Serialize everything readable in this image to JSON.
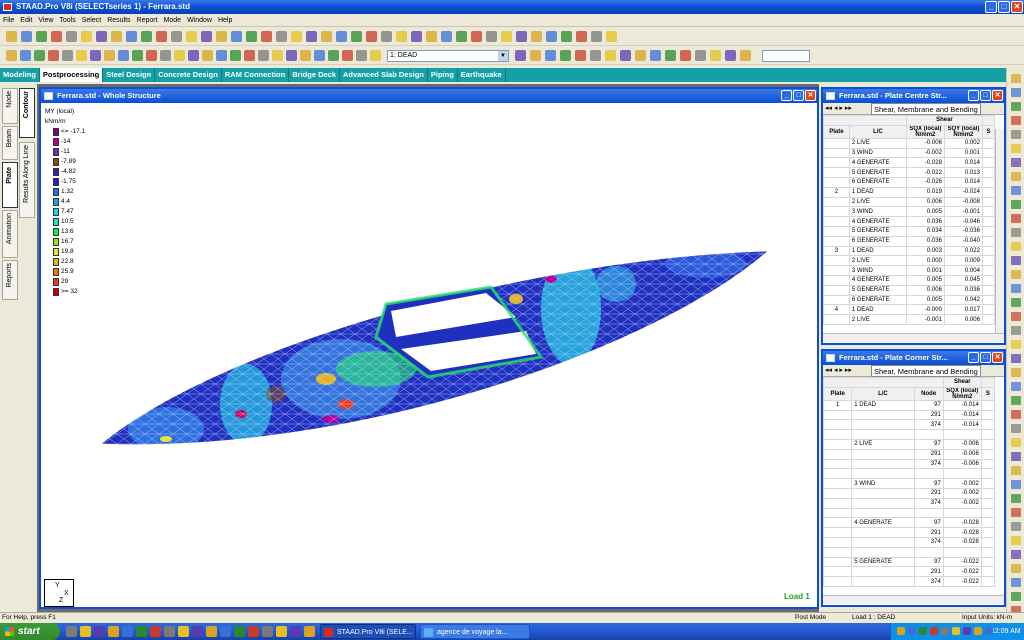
{
  "app": {
    "title": "STAAD.Pro V8i (SELECTseries 1) - Ferrara.std",
    "window_buttons": [
      "_",
      "□",
      "✕"
    ]
  },
  "menu": [
    "File",
    "Edit",
    "View",
    "Tools",
    "Select",
    "Results",
    "Report",
    "Mode",
    "Window",
    "Help"
  ],
  "toolbar": {
    "loadcase_selected": "1: DEAD"
  },
  "page_tabs": [
    {
      "label": "Modeling",
      "active": false
    },
    {
      "label": "Postprocessing",
      "active": true
    },
    {
      "label": "Steel Design",
      "active": false
    },
    {
      "label": "Concrete Design",
      "active": false
    },
    {
      "label": "RAM Connection",
      "active": false
    },
    {
      "label": "Bridge Deck",
      "active": false
    },
    {
      "label": "Advanced Slab Design",
      "active": false
    },
    {
      "label": "Piping",
      "active": false
    },
    {
      "label": "Earthquake",
      "active": false
    }
  ],
  "side_tabs": {
    "outer": [
      "Node",
      "Beam",
      "Plate",
      "Animation",
      "Reports"
    ],
    "inner": [
      "Contour",
      "Results Along Line"
    ],
    "active_outer": "Plate"
  },
  "structure_window": {
    "title": "Ferrara.std - Whole Structure",
    "legend_title": [
      "MY (local)",
      "kNm/m"
    ],
    "legend": [
      {
        "label": "<= -17.1",
        "color": "#800080"
      },
      {
        "label": "-14",
        "color": "#b4009a"
      },
      {
        "label": "-11",
        "color": "#6e2fa8"
      },
      {
        "label": "-7.89",
        "color": "#7a4a22"
      },
      {
        "label": "-4.82",
        "color": "#3a1fa8"
      },
      {
        "label": "-1.75",
        "color": "#2222c8"
      },
      {
        "label": "1.32",
        "color": "#2d6ae6"
      },
      {
        "label": "4.4",
        "color": "#1fa0e6"
      },
      {
        "label": "7.47",
        "color": "#1ed2e6"
      },
      {
        "label": "10.5",
        "color": "#1ee6b4"
      },
      {
        "label": "13.6",
        "color": "#22e65a"
      },
      {
        "label": "16.7",
        "color": "#8ee622"
      },
      {
        "label": "19.8",
        "color": "#e6e622"
      },
      {
        "label": "22.8",
        "color": "#e6b422"
      },
      {
        "label": "25.9",
        "color": "#e67822"
      },
      {
        "label": "29",
        "color": "#e63c22"
      },
      {
        "label": ">= 32",
        "color": "#c80000"
      }
    ],
    "load_label": "Load 1",
    "axis": {
      "y": "Y",
      "x": "X",
      "z": "Z"
    }
  },
  "centre_table": {
    "title": "Ferrara.std - Plate Centre Str...",
    "tab": "Shear, Membrane and Bending",
    "group_header": "Shear",
    "headers": [
      "Plate",
      "L/C",
      "SQX (local) N/mm2",
      "SQY (local) N/mm2",
      "S"
    ],
    "rows": [
      [
        "",
        "2 LIVE",
        "-0.006",
        "0.002"
      ],
      [
        "",
        "3 WIND",
        "-0.002",
        "0.001"
      ],
      [
        "",
        "4 GENERATE",
        "-0.028",
        "0.014"
      ],
      [
        "",
        "5 GENERATE",
        "-0.022",
        "0.013"
      ],
      [
        "",
        "6 GENERATE",
        "-0.026",
        "0.014"
      ],
      [
        "2",
        "1 DEAD",
        "0.019",
        "-0.024"
      ],
      [
        "",
        "2 LIVE",
        "0.006",
        "-0.008"
      ],
      [
        "",
        "3 WIND",
        "0.005",
        "-0.001"
      ],
      [
        "",
        "4 GENERATE",
        "0.036",
        "-0.046"
      ],
      [
        "",
        "5 GENERATE",
        "0.034",
        "-0.036"
      ],
      [
        "",
        "6 GENERATE",
        "0.036",
        "-0.040"
      ],
      [
        "3",
        "1 DEAD",
        "0.003",
        "0.022"
      ],
      [
        "",
        "2 LIVE",
        "0.000",
        "0.009"
      ],
      [
        "",
        "3 WIND",
        "0.001",
        "0.004"
      ],
      [
        "",
        "4 GENERATE",
        "0.005",
        "0.045"
      ],
      [
        "",
        "5 GENERATE",
        "0.006",
        "0.036"
      ],
      [
        "",
        "6 GENERATE",
        "0.005",
        "0.042"
      ],
      [
        "4",
        "1 DEAD",
        "-0.000",
        "0.017"
      ],
      [
        "",
        "2 LIVE",
        "-0.001",
        "0.006"
      ]
    ]
  },
  "corner_table": {
    "title": "Ferrara.std - Plate Corner Str...",
    "tab": "Shear, Membrane and Bending",
    "group_header": "Shear",
    "headers": [
      "Plate",
      "L/C",
      "Node",
      "SQX (local) N/mm2",
      "S"
    ],
    "rows": [
      [
        "1",
        "1 DEAD",
        "97",
        "-0.014"
      ],
      [
        "",
        "",
        "291",
        "-0.014"
      ],
      [
        "",
        "",
        "374",
        "-0.014"
      ],
      [
        "",
        "",
        "",
        ""
      ],
      [
        "",
        "2 LIVE",
        "97",
        "-0.006"
      ],
      [
        "",
        "",
        "291",
        "-0.006"
      ],
      [
        "",
        "",
        "374",
        "-0.006"
      ],
      [
        "",
        "",
        "",
        ""
      ],
      [
        "",
        "3 WIND",
        "97",
        "-0.002"
      ],
      [
        "",
        "",
        "291",
        "-0.002"
      ],
      [
        "",
        "",
        "374",
        "-0.002"
      ],
      [
        "",
        "",
        "",
        ""
      ],
      [
        "",
        "4 GENERATE",
        "97",
        "-0.028"
      ],
      [
        "",
        "",
        "291",
        "-0.028"
      ],
      [
        "",
        "",
        "374",
        "-0.028"
      ],
      [
        "",
        "",
        "",
        ""
      ],
      [
        "",
        "5 GENERATE",
        "97",
        "-0.022"
      ],
      [
        "",
        "",
        "291",
        "-0.022"
      ],
      [
        "",
        "",
        "374",
        "-0.022"
      ]
    ]
  },
  "status": {
    "help": "For Help, press F1",
    "mode": "Post Mode",
    "load": "Load 1 : DEAD",
    "units": "Input Units:  kN-m"
  },
  "taskbar": {
    "start": "start",
    "tasks": [
      "STAAD.Pro V8i (SELE...",
      "agence de voyage la..."
    ],
    "clock": "12:09 AM"
  }
}
